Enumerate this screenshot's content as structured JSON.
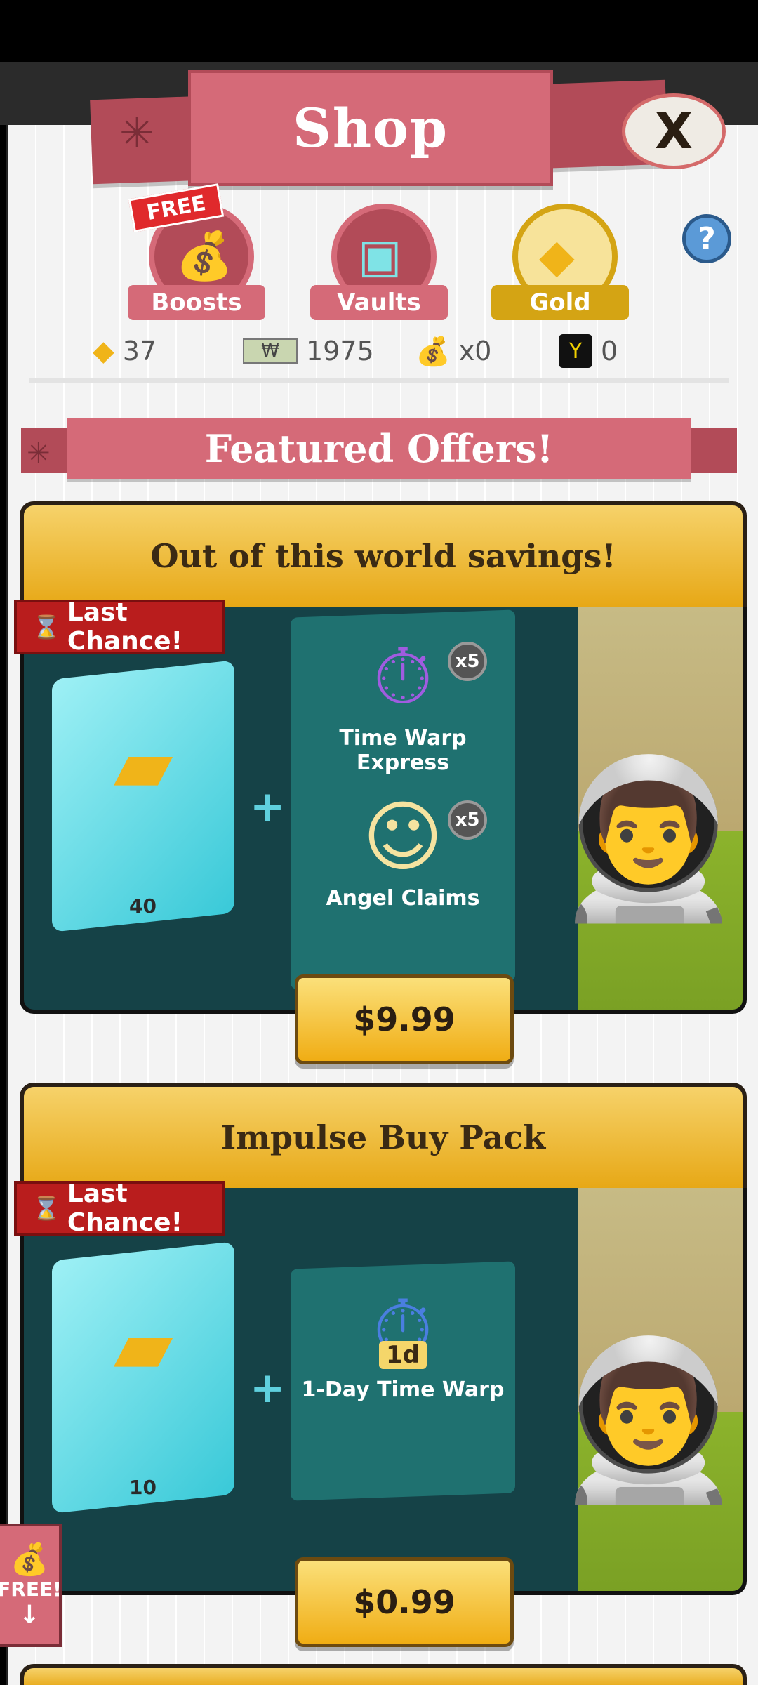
{
  "header": {
    "title": "Shop",
    "close_label": "X"
  },
  "categories": [
    {
      "label": "Boosts",
      "icon": "boost-bag-icon",
      "badge": "FREE",
      "color": "#d56a78",
      "selected": false
    },
    {
      "label": "Vaults",
      "icon": "vault-icon",
      "color": "#d56a78",
      "selected": false
    },
    {
      "label": "Gold",
      "icon": "gold-icon",
      "color": "#d4a414",
      "selected": true
    }
  ],
  "help_label": "?",
  "currencies": [
    {
      "icon": "gold-icon",
      "value": "37"
    },
    {
      "icon": "mega-bucks-icon",
      "value": "1975"
    },
    {
      "icon": "money-bag-icon",
      "value": "x0"
    },
    {
      "icon": "mega-ticket-icon",
      "value": "0"
    }
  ],
  "featured": {
    "title": "Featured Offers!"
  },
  "offers": [
    {
      "title": "Out of this world savings!",
      "ribbon": "Last Chance!",
      "gold_amount": "40",
      "items": [
        {
          "label": "Time Warp Express",
          "qty": "x5",
          "icon": "time-warp-express-icon"
        },
        {
          "label": "Angel Claims",
          "qty": "x5",
          "icon": "angel-claims-icon"
        }
      ],
      "price": "$9.99"
    },
    {
      "title": "Impulse Buy Pack",
      "ribbon": "Last Chance!",
      "gold_amount": "10",
      "items": [
        {
          "label": "1-Day Time Warp",
          "icon": "one-day-time-warp-icon",
          "overlay": "1d"
        }
      ],
      "price": "$0.99"
    }
  ],
  "free_side": {
    "label": "FREE!",
    "arrow": "↓"
  }
}
